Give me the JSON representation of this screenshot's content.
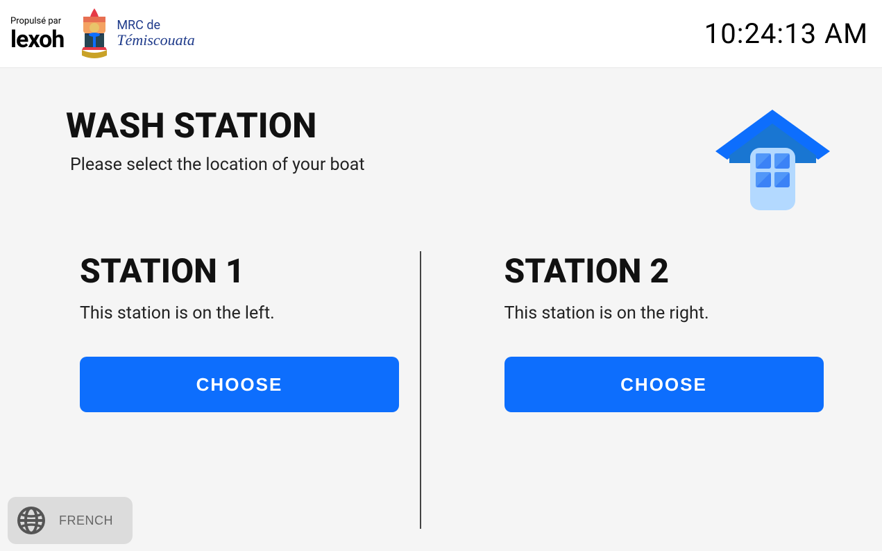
{
  "header": {
    "powered_by": "Propulsé par",
    "brand": "lexoh",
    "partner_top": "MRC de",
    "partner_bottom": "Témiscouata",
    "clock": "10:24:13 AM"
  },
  "page": {
    "title": "WASH STATION",
    "subtitle": "Please select the location of your boat"
  },
  "stations": [
    {
      "title": "STATION 1",
      "description": "This station is on the left.",
      "button": "CHOOSE"
    },
    {
      "title": "STATION 2",
      "description": "This station is on the right.",
      "button": "CHOOSE"
    }
  ],
  "language": {
    "label": "FRENCH"
  }
}
